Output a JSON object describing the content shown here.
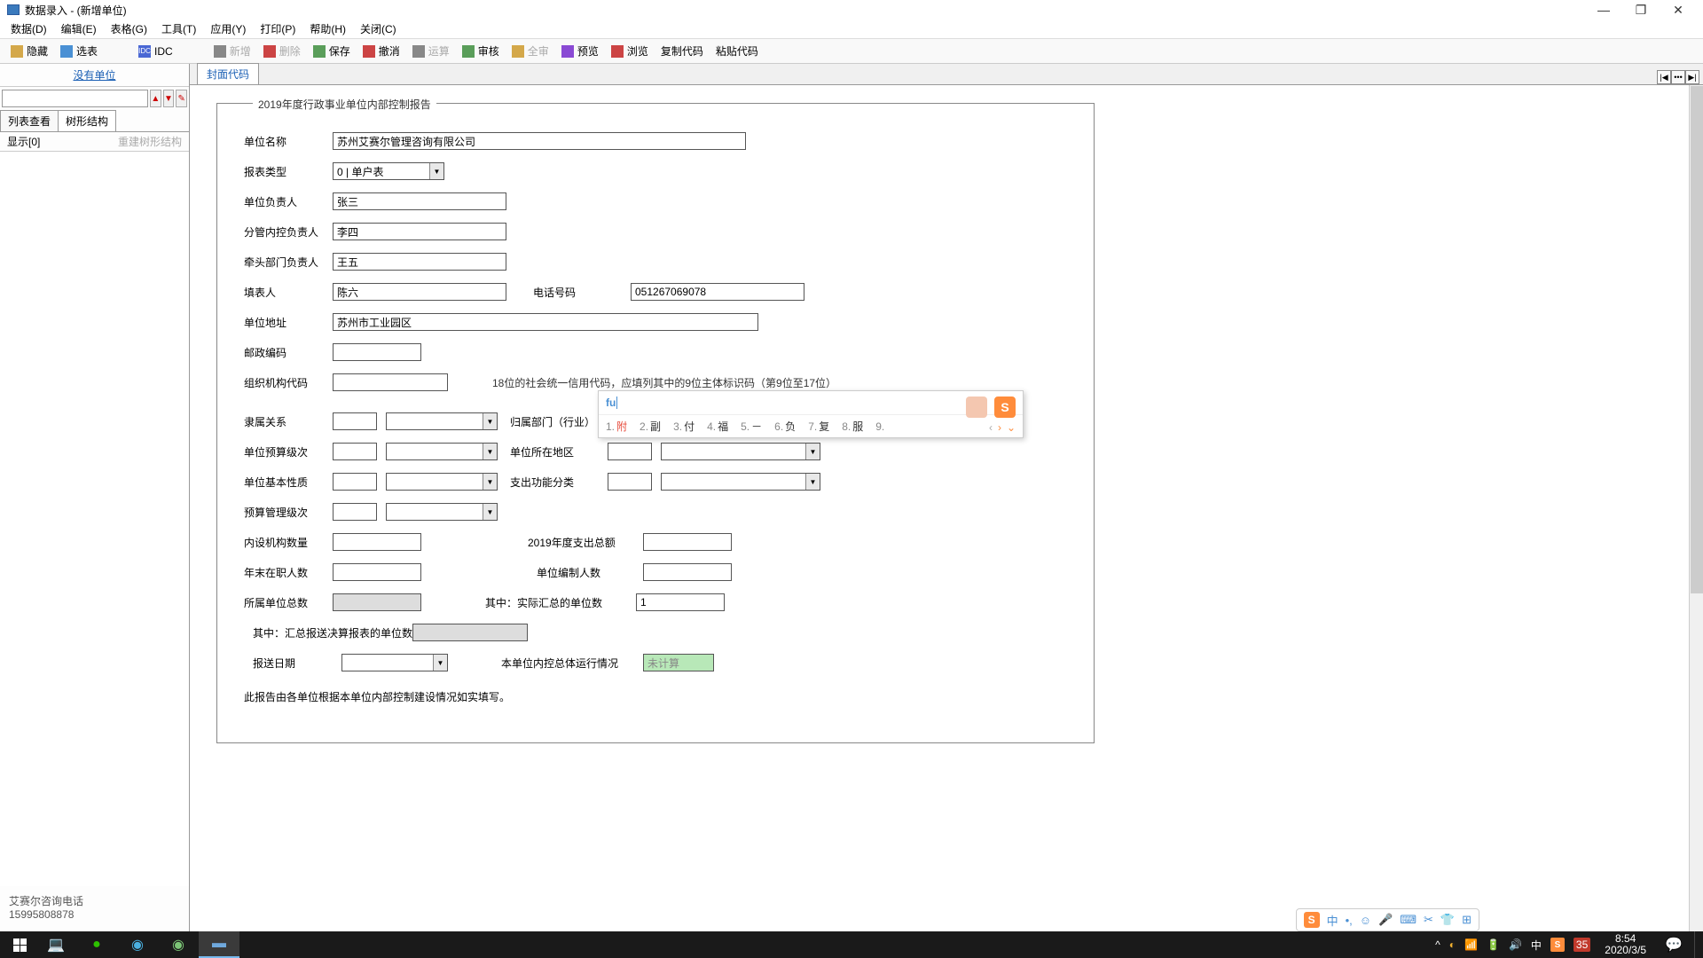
{
  "window": {
    "title": "数据录入 -  (新增单位)"
  },
  "menu": {
    "items": [
      "数据(D)",
      "编辑(E)",
      "表格(G)",
      "工具(T)",
      "应用(Y)",
      "打印(P)",
      "帮助(H)",
      "关闭(C)"
    ]
  },
  "toolbar": {
    "hide": "隐藏",
    "select": "选表",
    "idc": "IDC",
    "new": "新增",
    "delete": "删除",
    "save": "保存",
    "cancel": "撤消",
    "calc": "运算",
    "audit": "审核",
    "allaudit": "全审",
    "preview": "预览",
    "browse": "浏览",
    "copycode": "复制代码",
    "pastecode": "粘贴代码"
  },
  "sidebar": {
    "nounit": "没有单位",
    "tabs": {
      "list": "列表查看",
      "tree": "树形结构"
    },
    "display": "显示[0]",
    "rebuild": "重建树形结构",
    "footer1": "艾赛尔咨询电话",
    "footer2": "15995808878"
  },
  "maintab": "封面代码",
  "form": {
    "legend": "2019年度行政事业单位内部控制报告",
    "unit_name_lbl": "单位名称",
    "unit_name": "苏州艾赛尔管理咨询有限公司",
    "report_type_lbl": "报表类型",
    "report_type": "0 | 单户表",
    "head_lbl": "单位负责人",
    "head": "张三",
    "head_cursor": "I",
    "nk_lbl": "分管内控负责人",
    "nk": "李四",
    "qt_lbl": "牵头部门负责人",
    "qt": "王五",
    "filler_lbl": "填表人",
    "filler": "陈六",
    "phone_lbl": "电话号码",
    "phone": "051267069078",
    "addr_lbl": "单位地址",
    "addr": "苏州市工业园区",
    "zip_lbl": "邮政编码",
    "zip": "",
    "org_lbl": "组织机构代码",
    "org": "",
    "org_note": "18位的社会统一信用代码，应填列其中的9位主体标识码（第9位至17位）",
    "rel_lbl": "隶属关系",
    "dept_lbl": "归属部门（行业）",
    "budget_lbl": "单位预算级次",
    "loc_lbl": "单位所在地区",
    "nature_lbl": "单位基本性质",
    "func_lbl": "支出功能分类",
    "mgmt_lbl": "预算管理级次",
    "inst_lbl": "内设机构数量",
    "expend_lbl": "2019年度支出总额",
    "emp_lbl": "年末在职人数",
    "staff_lbl": "单位编制人数",
    "subunit_lbl": "所属单位总数",
    "actual_lbl": "其中：实际汇总的单位数",
    "actual_val": "1",
    "summary_lbl": "其中：汇总报送决算报表的单位数",
    "date_lbl": "报送日期",
    "overall_lbl": "本单位内控总体运行情况",
    "overall_val": "未计算",
    "footnote": "此报告由各单位根据本单位内部控制建设情况如实填写。"
  },
  "ime": {
    "input": "fu",
    "candidates": [
      {
        "n": "1.",
        "t": "附"
      },
      {
        "n": "2.",
        "t": "副"
      },
      {
        "n": "3.",
        "t": "付"
      },
      {
        "n": "4.",
        "t": "福"
      },
      {
        "n": "5.",
        "t": "－"
      },
      {
        "n": "6.",
        "t": "负"
      },
      {
        "n": "7.",
        "t": "复"
      },
      {
        "n": "8.",
        "t": "服"
      },
      {
        "n": "9.",
        "t": ""
      }
    ]
  },
  "imebar": {
    "items": [
      "中",
      "•,",
      "☺",
      "🎤",
      "⌨",
      "✂",
      "👕",
      "⊞"
    ]
  },
  "tray": {
    "items": [
      "^",
      "◐",
      "📶",
      "🔋",
      "🔊",
      "中",
      "S",
      "35"
    ],
    "time": "8:54",
    "date": "2020/3/5"
  }
}
